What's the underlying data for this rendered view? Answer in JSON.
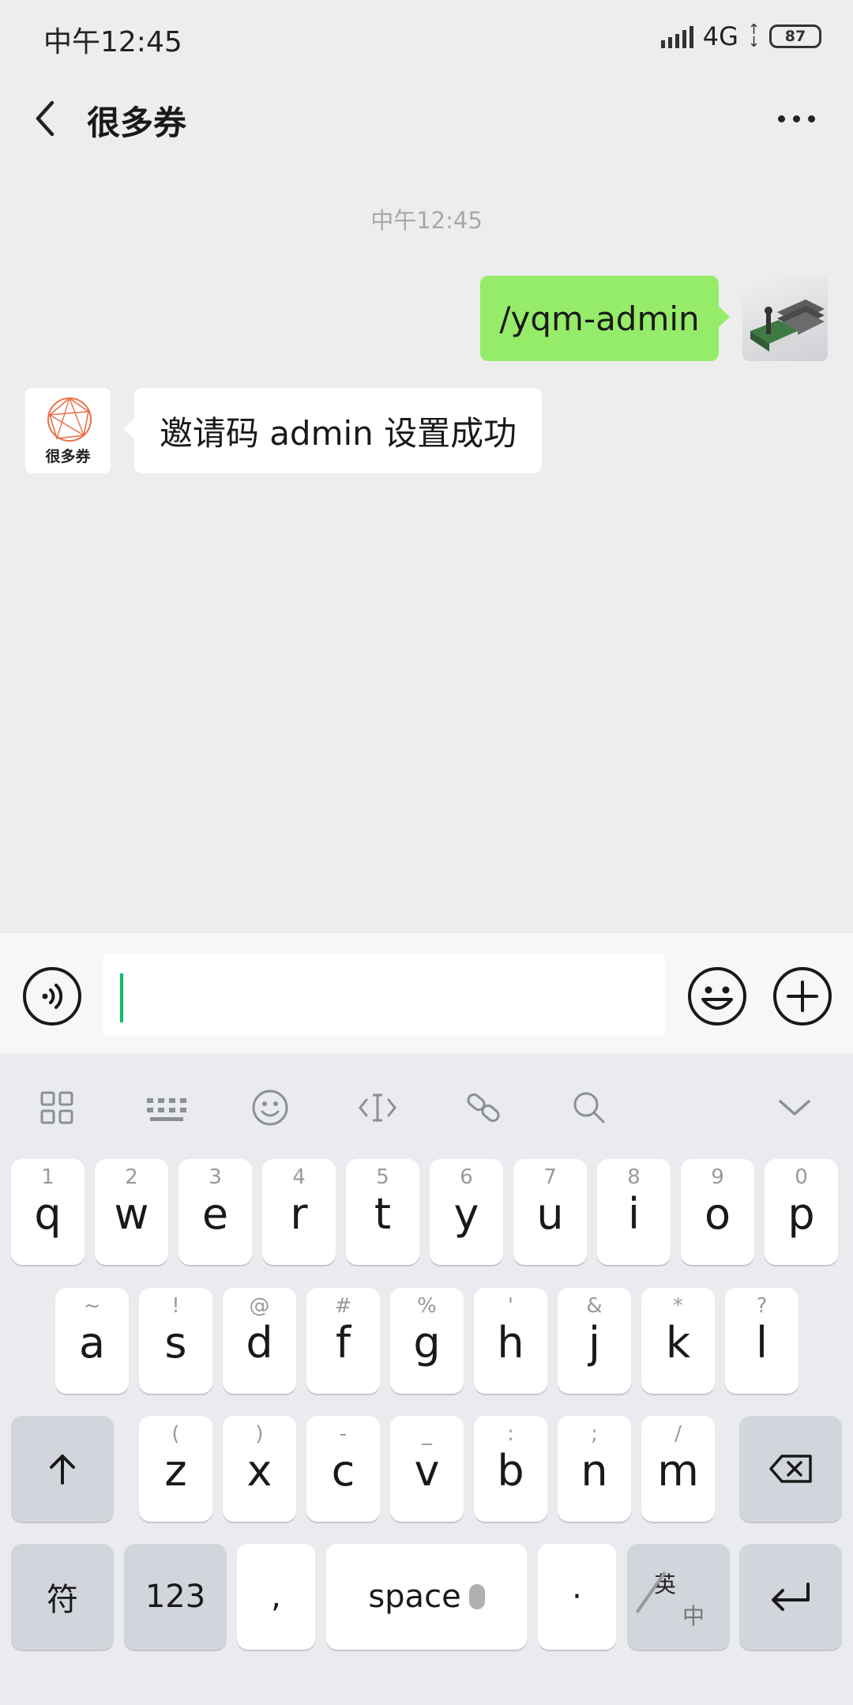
{
  "status_bar": {
    "time": "中午12:45",
    "network": "4G",
    "battery": "87"
  },
  "nav": {
    "title": "很多券",
    "back_icon": "chevron-left-icon",
    "more_icon": "more-dots-icon"
  },
  "chat": {
    "timestamp": "中午12:45",
    "messages": [
      {
        "from": "self",
        "text": "/yqm-admin"
      },
      {
        "from": "bot",
        "text": "邀请码 admin 设置成功",
        "avatar_label": "很多券"
      }
    ]
  },
  "input_bar": {
    "voice_icon": "voice-icon",
    "emoji_icon": "emoji-icon",
    "plus_icon": "plus-circle-icon",
    "value": ""
  },
  "keyboard": {
    "toolbar_icons": [
      "grid-icon",
      "keyboard-icon",
      "smiley-icon",
      "cursor-icon",
      "link-icon",
      "search-icon",
      "chevron-down-icon"
    ],
    "row1": [
      {
        "main": "q",
        "hint": "1"
      },
      {
        "main": "w",
        "hint": "2"
      },
      {
        "main": "e",
        "hint": "3"
      },
      {
        "main": "r",
        "hint": "4"
      },
      {
        "main": "t",
        "hint": "5"
      },
      {
        "main": "y",
        "hint": "6"
      },
      {
        "main": "u",
        "hint": "7"
      },
      {
        "main": "i",
        "hint": "8"
      },
      {
        "main": "o",
        "hint": "9"
      },
      {
        "main": "p",
        "hint": "0"
      }
    ],
    "row2": [
      {
        "main": "a",
        "hint": "~"
      },
      {
        "main": "s",
        "hint": "!"
      },
      {
        "main": "d",
        "hint": "@"
      },
      {
        "main": "f",
        "hint": "#"
      },
      {
        "main": "g",
        "hint": "%"
      },
      {
        "main": "h",
        "hint": "'"
      },
      {
        "main": "j",
        "hint": "&"
      },
      {
        "main": "k",
        "hint": "*"
      },
      {
        "main": "l",
        "hint": "?"
      }
    ],
    "row3": [
      {
        "main": "z",
        "hint": "("
      },
      {
        "main": "x",
        "hint": ")"
      },
      {
        "main": "c",
        "hint": "-"
      },
      {
        "main": "v",
        "hint": "_"
      },
      {
        "main": "b",
        "hint": ":"
      },
      {
        "main": "n",
        "hint": ";"
      },
      {
        "main": "m",
        "hint": "/"
      }
    ],
    "bottom": {
      "symbols": "符",
      "numbers": "123",
      "comma": ",",
      "space": "space",
      "period": "·",
      "lang_en": "英",
      "lang_zh": "中"
    }
  },
  "colors": {
    "sent_bubble": "#95ec69",
    "caret": "#07c160",
    "background": "#ededed"
  }
}
